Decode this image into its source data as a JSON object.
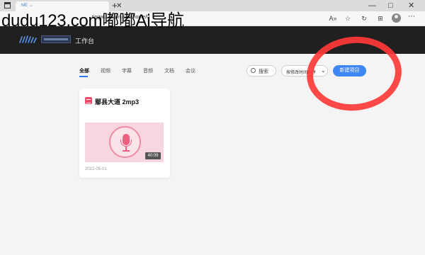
{
  "browser": {
    "tab_title": "ME ↔",
    "tab_close": "✕",
    "new_tab": "+",
    "window_controls": [
      "—",
      "□",
      "✕"
    ],
    "url": "tingwu.aliyun.com/home/0",
    "toolbar_icons": [
      "read-aloud-icon",
      "favorite-star-icon",
      "refresh-icon",
      "collections-icon",
      "extensions-icon",
      "profile-avatar-icon",
      "more-menu-icon"
    ]
  },
  "watermark": "dudu123.com嘟嘟Ai导航",
  "header": {
    "workbench_label": "工作台"
  },
  "filters": {
    "tabs": [
      "全部",
      "视频",
      "字幕",
      "音频",
      "文档",
      "会议"
    ],
    "active_index": 0,
    "search_label": "搜索",
    "sort_label": "按修改时间排序",
    "new_project_label": "新建项目"
  },
  "files": [
    {
      "name": "鄢县大道 2mp3",
      "duration": "40:09",
      "date": "2022-05-01",
      "thumbnail_color": "#f8d6df"
    }
  ],
  "colors": {
    "accent": "#3d86f3",
    "header_bg": "#202020",
    "annotation": "#ff3a3a"
  }
}
